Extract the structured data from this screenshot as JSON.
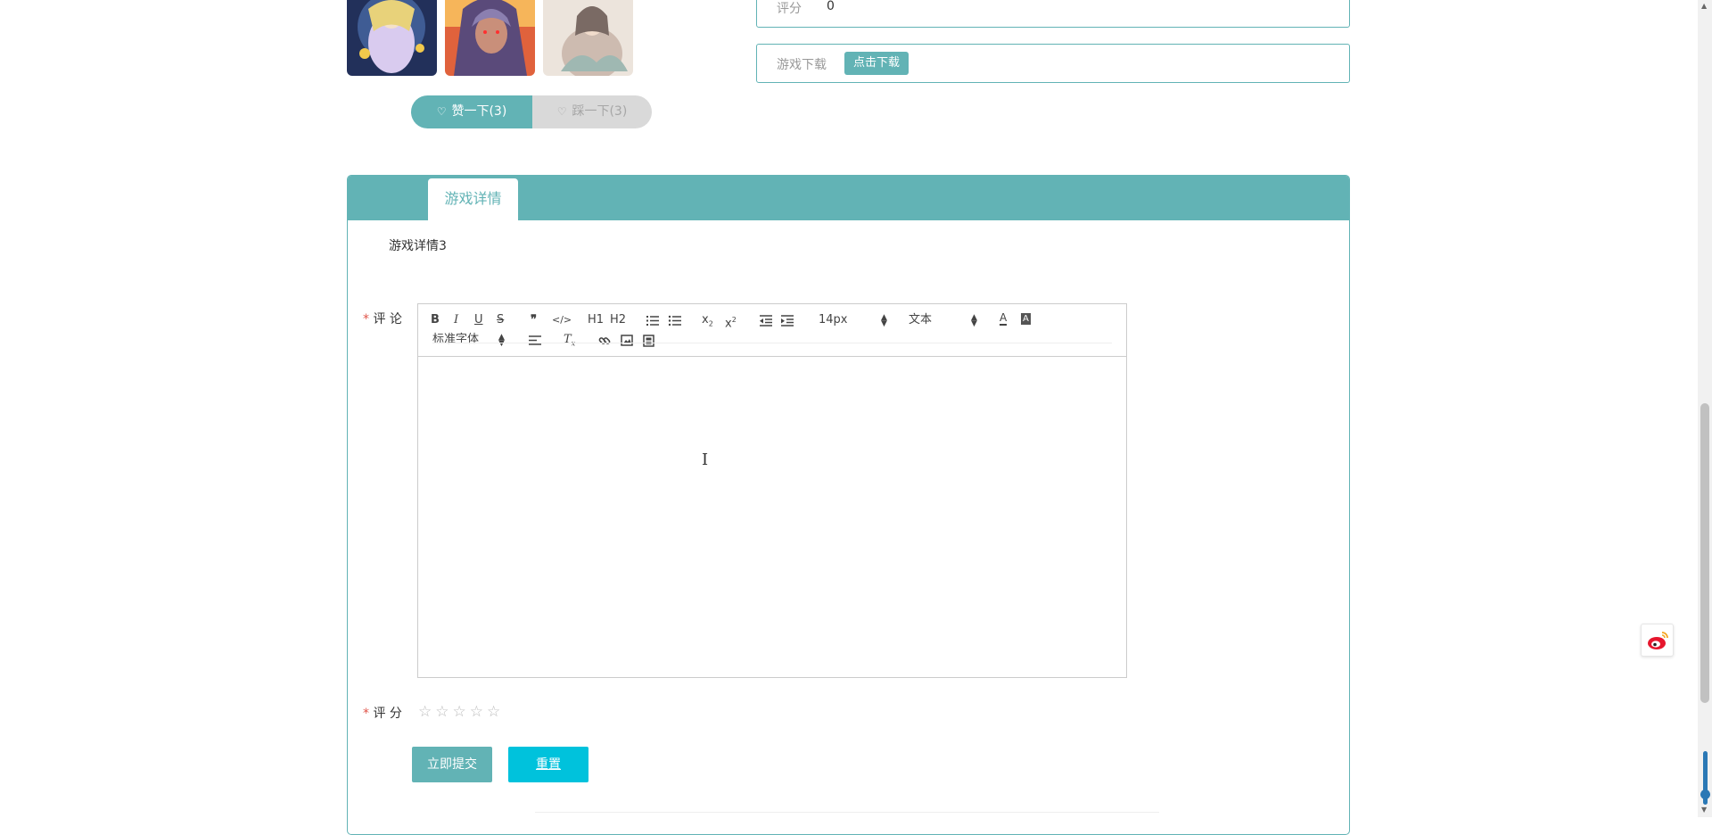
{
  "thumbnails": [
    {
      "name": "game-image-1",
      "palette": [
        "#2b3a6a",
        "#d7c8ee",
        "#e8d27a"
      ]
    },
    {
      "name": "game-image-2",
      "palette": [
        "#7a4a6e",
        "#e0623c",
        "#f6c35a"
      ]
    },
    {
      "name": "game-image-3",
      "palette": [
        "#e9dfd7",
        "#c8b4a9",
        "#8aa6a0"
      ]
    }
  ],
  "rating_info": {
    "label": "评分",
    "value": "0"
  },
  "download_info": {
    "label": "游戏下载",
    "button": "点击下载"
  },
  "votes": {
    "like": "赞一下(3)",
    "dislike": "踩一下(3)"
  },
  "detail": {
    "tab": "游戏详情",
    "text": "游戏详情3"
  },
  "comment_form": {
    "comment_label": "评 论",
    "required_mark": "*",
    "toolbar": {
      "font_size": "14px",
      "header_type": "文本",
      "font_family": "标准字体",
      "h1": "H1",
      "h2": "H2"
    },
    "score_label": "评 分",
    "stars": [
      "☆",
      "☆",
      "☆",
      "☆",
      "☆"
    ],
    "submit": "立即提交",
    "reset": "重置"
  },
  "colors": {
    "accent": "#62b3b5",
    "reset": "#00c2dc",
    "weibo": "#e6162d"
  }
}
